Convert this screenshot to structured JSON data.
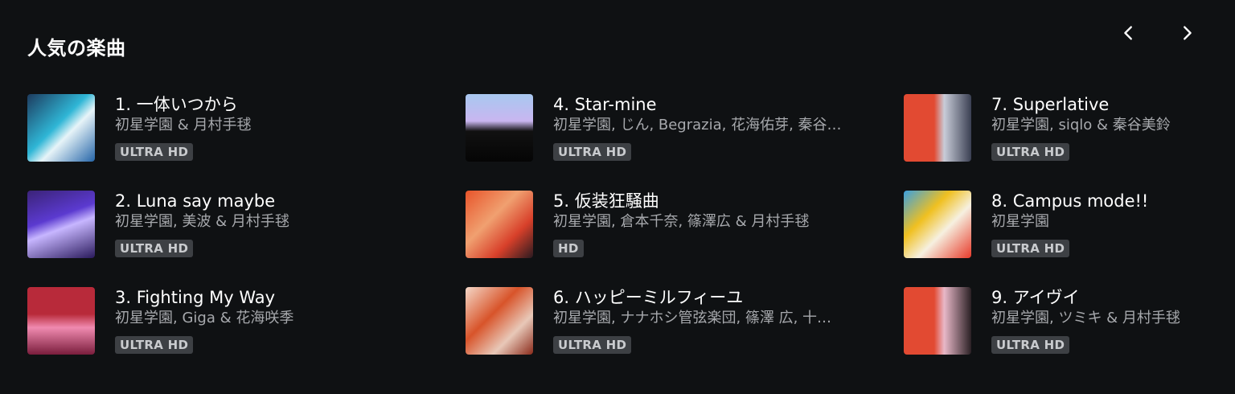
{
  "section": {
    "title": "人気の楽曲"
  },
  "nav": {
    "prev_icon": "chevron-left-icon",
    "next_icon": "chevron-right-icon"
  },
  "tracks": [
    {
      "title": "1. 一体いつから",
      "artist": "初星学園 & 月村手毬",
      "badge": "ULTRA HD"
    },
    {
      "title": "2. Luna say maybe",
      "artist": "初星学園, 美波 & 月村手毬",
      "badge": "ULTRA HD"
    },
    {
      "title": "3. Fighting My Way",
      "artist": "初星学園, Giga & 花海咲季",
      "badge": "ULTRA HD"
    },
    {
      "title": "4. Star-mine",
      "artist": "初星学園, じん, Begrazia, 花海佑芽, 秦谷…",
      "badge": "ULTRA HD"
    },
    {
      "title": "5. 仮装狂騒曲",
      "artist": "初星学園, 倉本千奈, 篠澤広 & 月村手毬",
      "badge": "HD"
    },
    {
      "title": "6. ハッピーミルフィーユ",
      "artist": "初星学園, ナナホシ管弦楽団, 篠澤 広, 十…",
      "badge": "ULTRA HD"
    },
    {
      "title": "7. Superlative",
      "artist": "初星学園, siqlo & 秦谷美鈴",
      "badge": "ULTRA HD"
    },
    {
      "title": "8. Campus mode!!",
      "artist": "初星学園",
      "badge": "ULTRA HD"
    },
    {
      "title": "9. アイヴイ",
      "artist": "初星学園, ツミキ & 月村手毬",
      "badge": "ULTRA HD"
    }
  ]
}
